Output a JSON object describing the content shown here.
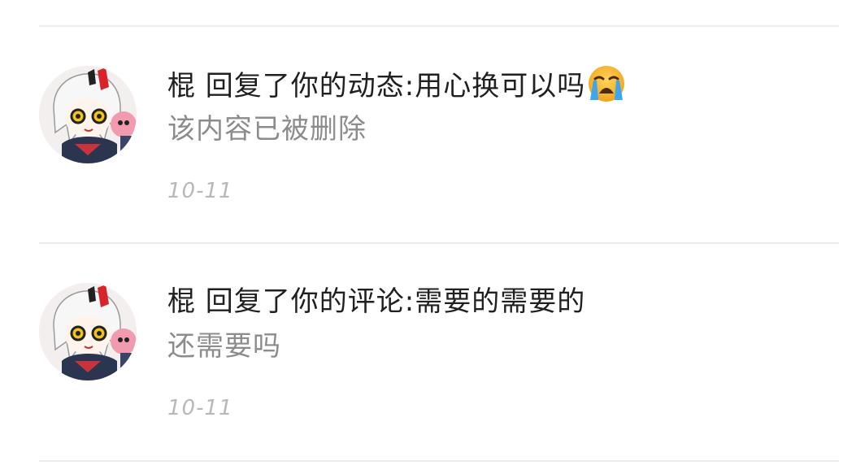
{
  "notifications": [
    {
      "reply_text": "棍 回复了你的动态:用心换可以吗",
      "emoji": "loudly-crying-face",
      "quoted_text": "该内容已被删除",
      "time": "10-11"
    },
    {
      "reply_text": "棍 回复了你的评论:需要的需要的",
      "quoted_text": "还需要吗",
      "time": "10-11"
    }
  ]
}
